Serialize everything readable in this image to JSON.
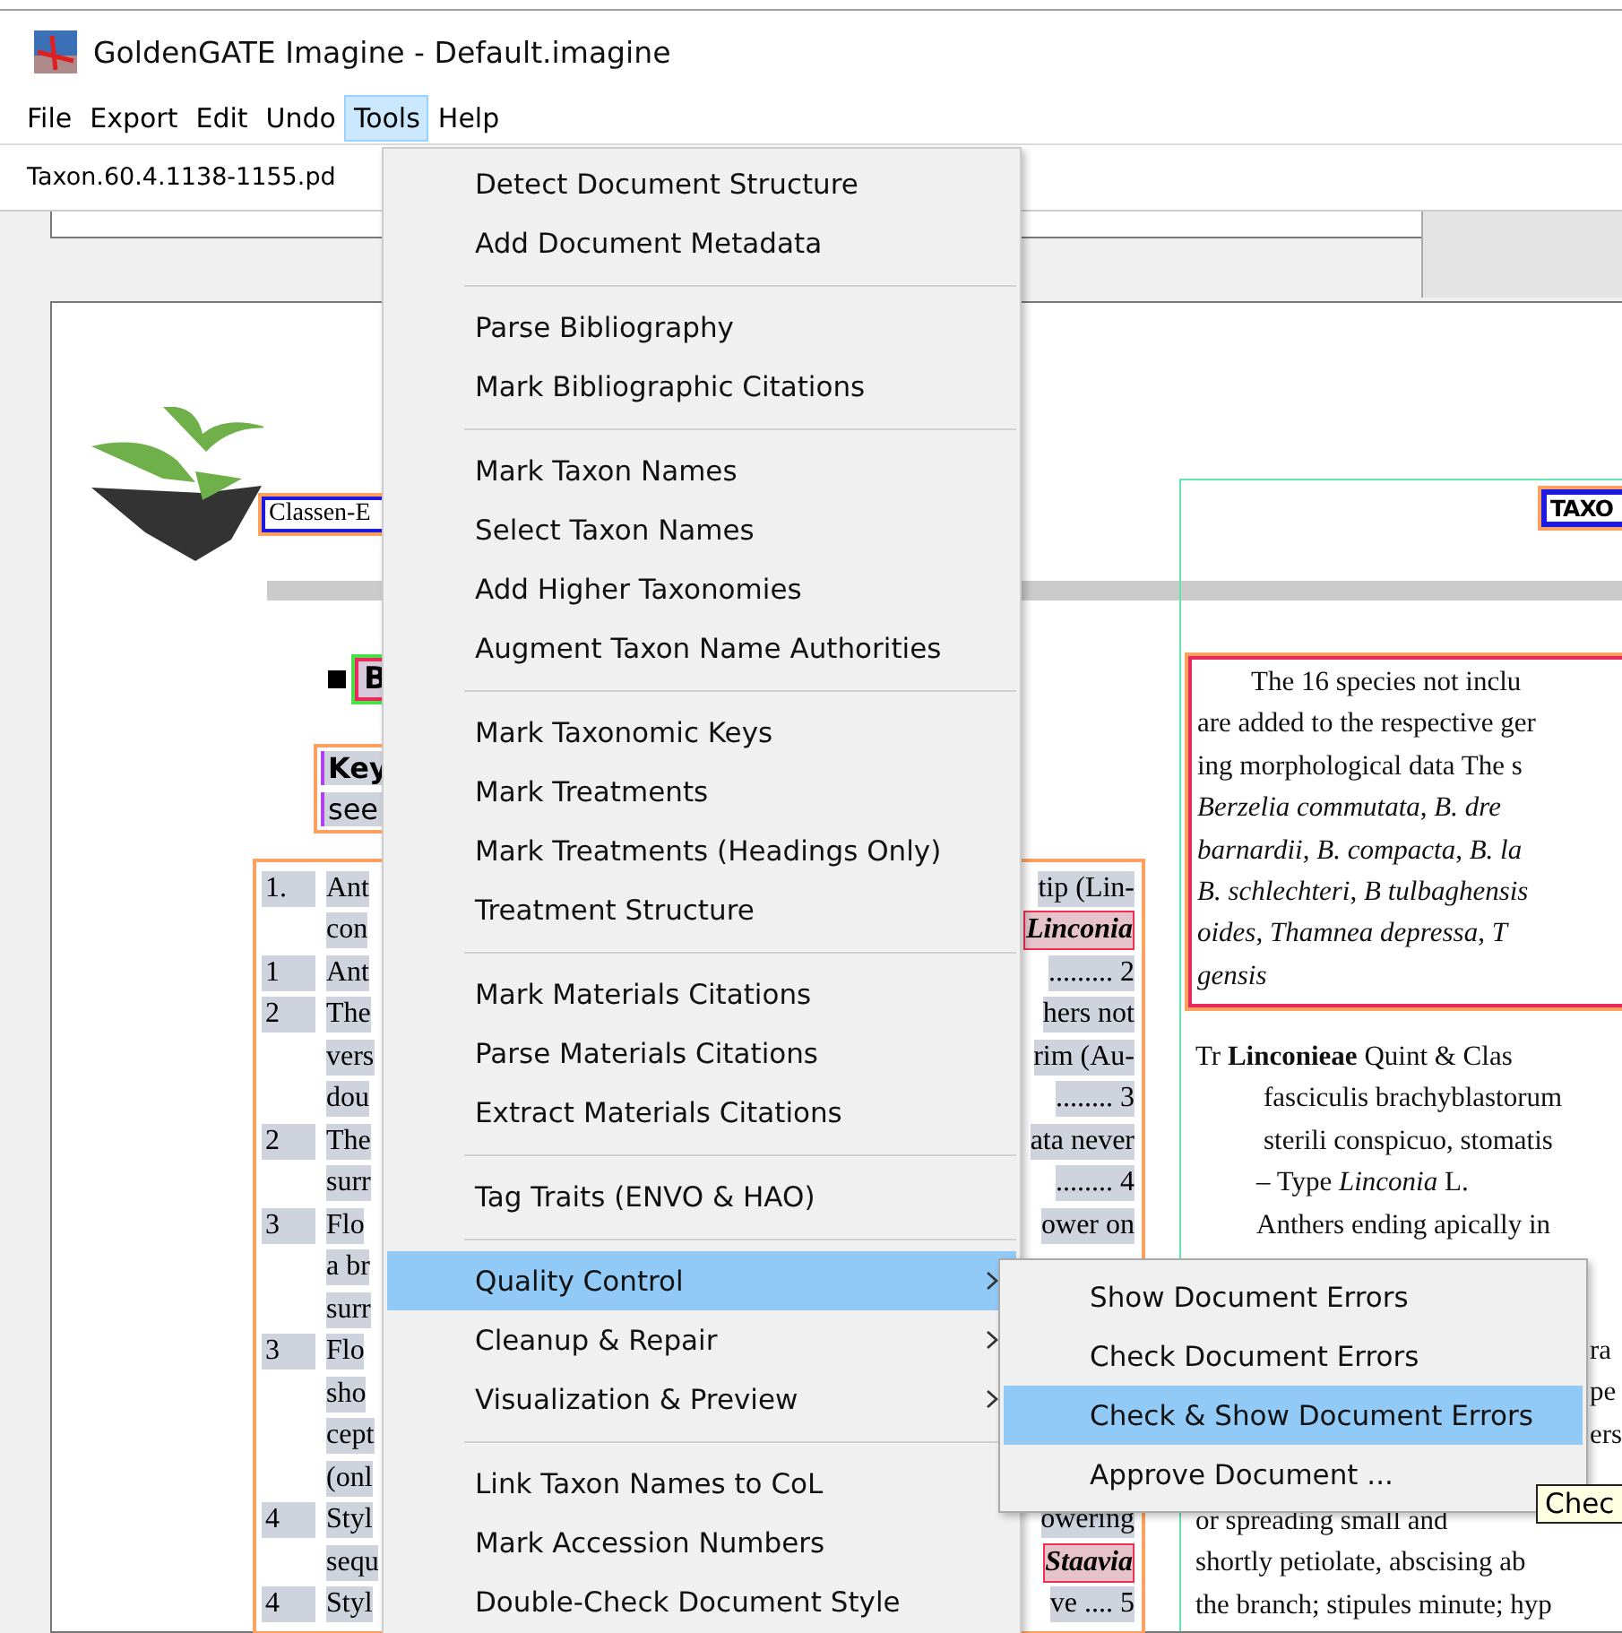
{
  "window": {
    "title": "GoldenGATE Imagine - Default.imagine"
  },
  "menubar": [
    {
      "label": "File",
      "selected": false
    },
    {
      "label": "Export",
      "selected": false
    },
    {
      "label": "Edit",
      "selected": false
    },
    {
      "label": "Undo",
      "selected": false
    },
    {
      "label": "Tools",
      "selected": true
    },
    {
      "label": "Help",
      "selected": false
    }
  ],
  "document_tab": {
    "label": "Taxon.60.4.1138-1155.pd"
  },
  "left_page": {
    "author_label": "Classen-E",
    "heading": "B",
    "key_title": "Key",
    "key_note": "see",
    "rows": [
      {
        "num": "1.",
        "text": "Ant",
        "tail": "tip (Lin-",
        "taxon": false
      },
      {
        "text": "con",
        "tail": "Linconia",
        "taxon": true
      },
      {
        "num": "1",
        "text": "Ant",
        "tail": "......... 2",
        "taxon": false
      },
      {
        "num": "2",
        "text": "The",
        "tail": "hers not",
        "taxon": false
      },
      {
        "text": "vers",
        "tail": "rim (Au-",
        "taxon": false
      },
      {
        "text": "dou",
        "tail": "........ 3",
        "taxon": false
      },
      {
        "num": "2",
        "text": "The",
        "tail": "ata never",
        "taxon": false
      },
      {
        "text": "surr",
        "tail": "........ 4",
        "taxon": false
      },
      {
        "num": "3",
        "text": "Flo",
        "tail": "ower on",
        "taxon": false
      },
      {
        "text": "a br"
      },
      {
        "text": "surr"
      },
      {
        "num": "3",
        "text": "Flo"
      },
      {
        "text": "sho"
      },
      {
        "text": "cept"
      },
      {
        "text": "(onl"
      },
      {
        "num": "4",
        "text": "Styl",
        "tail": "owering",
        "taxon": false
      },
      {
        "text": "sequ",
        "tail": "Staavia",
        "taxon": true
      },
      {
        "num": "4",
        "text": "Styl",
        "tail": "ve .... 5",
        "taxon": false
      }
    ]
  },
  "right_page": {
    "heading": "TAXO",
    "paragraph": [
      "The 16 species not inclu",
      "are added to the respective ger",
      "ing morphological data The s",
      "*Berzelia commutata*, *B. dre*",
      "*barnardii*, *B. compacta*, *B. la*",
      "*B. schlechteri*, *B tulbaghensis*",
      "*oides*, *Thamnea depressa*, *T*",
      "*gensis*"
    ],
    "treatment": [
      "Tr **Linconieae** Quint & Clas",
      "fasciculis brachyblastorum",
      "sterili conspicuo, stomatis",
      "– Type *Linconia* L.",
      "Anthers ending apically in"
    ],
    "fragments": [
      "ra",
      "pe",
      "ers"
    ],
    "description": [
      "or spreading small and",
      "shortly petiolate, abscising ab",
      "the branch; stipules minute; hyp"
    ]
  },
  "tools_menu": {
    "sections": [
      {
        "items": [
          {
            "label": "Detect Document Structure",
            "selected": false,
            "has_submenu": false
          },
          {
            "label": "Add Document Metadata",
            "selected": false,
            "has_submenu": false
          }
        ]
      },
      {
        "items": [
          {
            "label": "Parse Bibliography",
            "selected": false,
            "has_submenu": false
          },
          {
            "label": "Mark Bibliographic Citations",
            "selected": false,
            "has_submenu": false
          }
        ]
      },
      {
        "items": [
          {
            "label": "Mark Taxon Names",
            "selected": false,
            "has_submenu": false
          },
          {
            "label": "Select Taxon Names",
            "selected": false,
            "has_submenu": false
          },
          {
            "label": "Add Higher Taxonomies",
            "selected": false,
            "has_submenu": false
          },
          {
            "label": "Augment Taxon Name Authorities",
            "selected": false,
            "has_submenu": false
          }
        ]
      },
      {
        "items": [
          {
            "label": "Mark Taxonomic Keys",
            "selected": false,
            "has_submenu": false
          },
          {
            "label": "Mark Treatments",
            "selected": false,
            "has_submenu": false
          },
          {
            "label": "Mark Treatments (Headings Only)",
            "selected": false,
            "has_submenu": false
          },
          {
            "label": "Treatment Structure",
            "selected": false,
            "has_submenu": false
          }
        ]
      },
      {
        "items": [
          {
            "label": "Mark Materials Citations",
            "selected": false,
            "has_submenu": false
          },
          {
            "label": "Parse Materials Citations",
            "selected": false,
            "has_submenu": false
          },
          {
            "label": "Extract Materials Citations",
            "selected": false,
            "has_submenu": false
          }
        ]
      },
      {
        "items": [
          {
            "label": "Tag Traits (ENVO & HAO)",
            "selected": false,
            "has_submenu": false
          }
        ]
      },
      {
        "items": [
          {
            "label": "Quality Control",
            "selected": true,
            "has_submenu": true
          },
          {
            "label": "Cleanup & Repair",
            "selected": false,
            "has_submenu": true
          },
          {
            "label": "Visualization & Preview",
            "selected": false,
            "has_submenu": true
          }
        ]
      },
      {
        "items": [
          {
            "label": "Link Taxon Names to CoL",
            "selected": false,
            "has_submenu": false
          },
          {
            "label": "Mark Accession Numbers",
            "selected": false,
            "has_submenu": false
          },
          {
            "label": "Double-Check Document Style",
            "selected": false,
            "has_submenu": false
          }
        ]
      }
    ]
  },
  "quality_submenu": [
    {
      "label": "Show Document Errors",
      "selected": false
    },
    {
      "label": "Check Document Errors",
      "selected": false
    },
    {
      "label": "Check & Show Document Errors",
      "selected": true
    },
    {
      "label": "Approve Document ...",
      "selected": false
    }
  ],
  "tooltip": {
    "text": "Chec"
  }
}
